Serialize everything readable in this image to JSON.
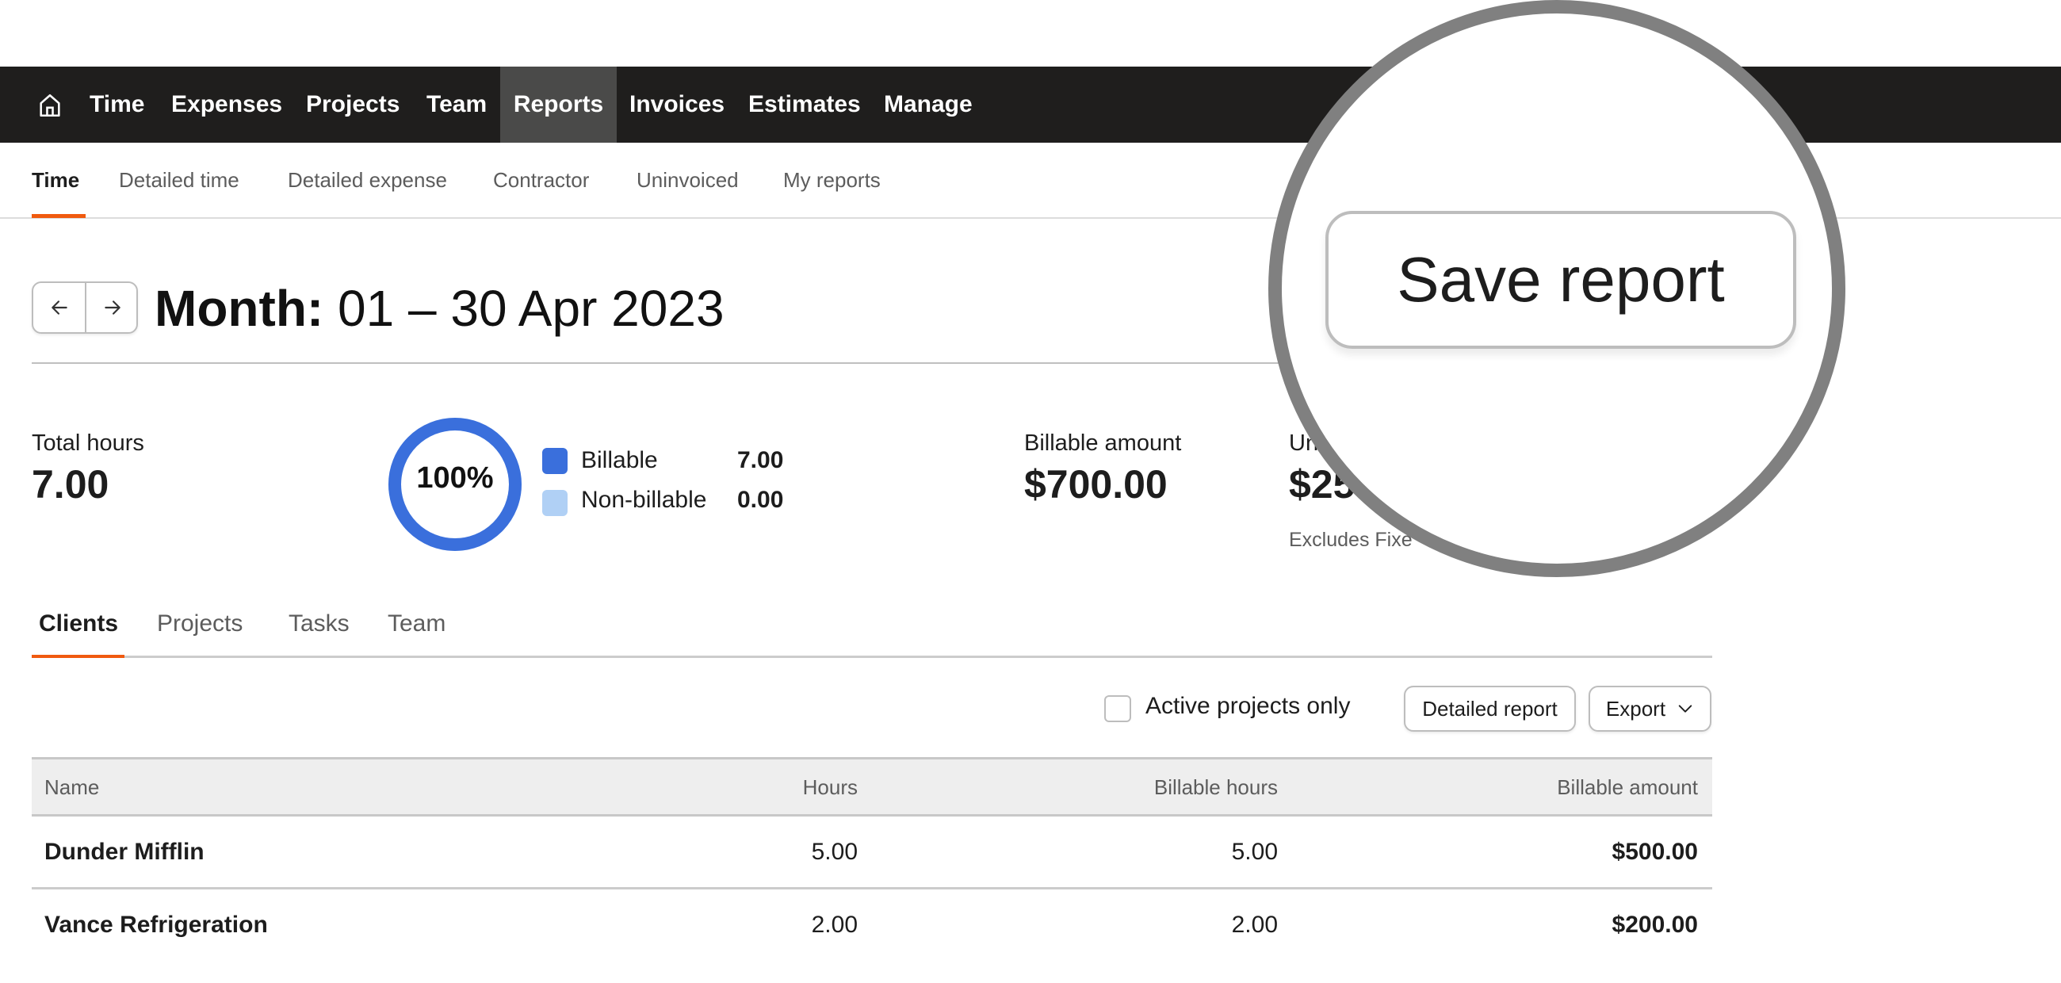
{
  "topnav": {
    "home_icon": "home-icon",
    "items": [
      {
        "label": "Time",
        "active": false
      },
      {
        "label": "Expenses",
        "active": false
      },
      {
        "label": "Projects",
        "active": false
      },
      {
        "label": "Team",
        "active": false
      },
      {
        "label": "Reports",
        "active": true
      },
      {
        "label": "Invoices",
        "active": false
      },
      {
        "label": "Estimates",
        "active": false
      },
      {
        "label": "Manage",
        "active": false
      }
    ]
  },
  "subtabs": [
    {
      "label": "Time",
      "active": true
    },
    {
      "label": "Detailed time",
      "active": false
    },
    {
      "label": "Detailed expense",
      "active": false
    },
    {
      "label": "Contractor",
      "active": false
    },
    {
      "label": "Uninvoiced",
      "active": false
    },
    {
      "label": "My reports",
      "active": false
    }
  ],
  "header": {
    "prev_icon": "arrow-left-icon",
    "next_icon": "arrow-right-icon",
    "period_label": "Month:",
    "period_range": "01 – 30 Apr 2023"
  },
  "stats": {
    "total_hours_label": "Total hours",
    "total_hours_value": "7.00",
    "billable_percent_label": "100%",
    "billable_fraction": 1.0,
    "legend": [
      {
        "label": "Billable",
        "value": "7.00",
        "color": "#3a6fdc"
      },
      {
        "label": "Non-billable",
        "value": "0.00",
        "color": "#b0d0f5"
      }
    ],
    "billable_amount_label": "Billable amount",
    "billable_amount_value": "$700.00",
    "uninvoiced_label_visible": "Un",
    "uninvoiced_value_visible": "$25",
    "uninvoiced_note_visible": "Excludes Fixe"
  },
  "tabs": [
    {
      "label": "Clients",
      "active": true
    },
    {
      "label": "Projects",
      "active": false
    },
    {
      "label": "Tasks",
      "active": false
    },
    {
      "label": "Team",
      "active": false
    }
  ],
  "toolbar": {
    "active_only_label": "Active projects only",
    "active_only_checked": false,
    "detailed_report_label": "Detailed report",
    "export_label": "Export",
    "export_icon": "chevron-down-icon"
  },
  "table": {
    "columns": [
      "Name",
      "Hours",
      "Billable hours",
      "Billable amount"
    ],
    "rows": [
      {
        "name": "Dunder Mifflin",
        "hours": "5.00",
        "billable_hours": "5.00",
        "billable_amount": "$500.00"
      },
      {
        "name": "Vance Refrigeration",
        "hours": "2.00",
        "billable_hours": "2.00",
        "billable_amount": "$200.00"
      }
    ]
  },
  "magnifier": {
    "save_report_label": "Save report"
  },
  "colors": {
    "accent": "#f05a0f",
    "nav_bg": "#1f1e1d",
    "nav_active_bg": "#4a4a49",
    "billable": "#3a6fdc",
    "non_billable": "#b0d0f5"
  }
}
